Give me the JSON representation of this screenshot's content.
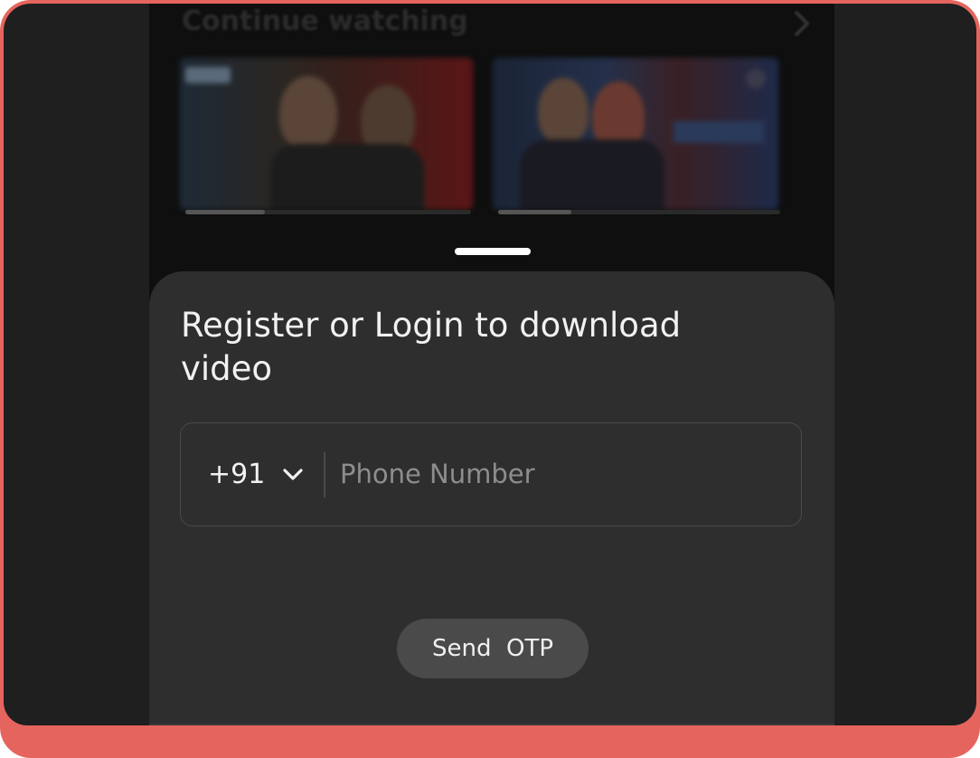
{
  "background": {
    "section_title": "Continue watching"
  },
  "sheet": {
    "title": "Register or Login to download video",
    "country_code": "+91",
    "phone_placeholder": "Phone Number",
    "send_otp_label": "Send  OTP"
  },
  "colors": {
    "accent_frame": "#e5655e",
    "sheet_bg": "#2e2e2e",
    "button_bg": "#4a4a4a"
  }
}
